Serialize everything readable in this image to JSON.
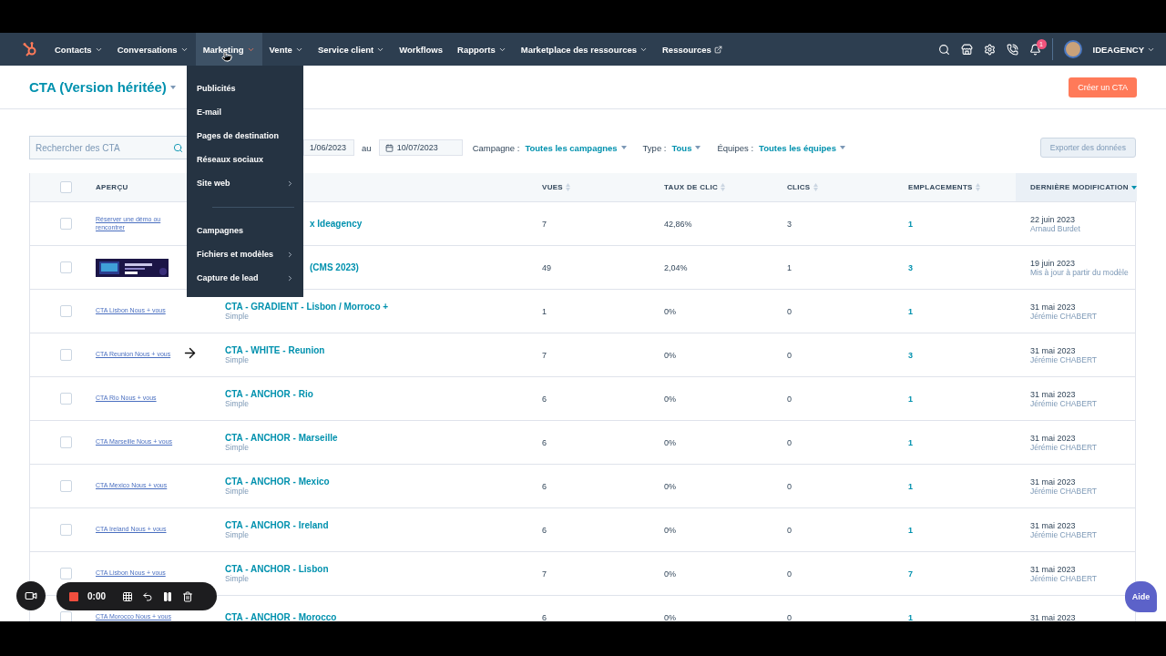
{
  "nav": {
    "items": [
      {
        "label": "Contacts",
        "kind": "dropdown",
        "selected": false
      },
      {
        "label": "Conversations",
        "kind": "dropdown",
        "selected": false
      },
      {
        "label": "Marketing",
        "kind": "dropdown",
        "selected": true
      },
      {
        "label": "Vente",
        "kind": "dropdown",
        "selected": false
      },
      {
        "label": "Service client",
        "kind": "dropdown",
        "selected": false
      },
      {
        "label": "Workflows",
        "kind": "plain",
        "selected": false
      },
      {
        "label": "Rapports",
        "kind": "dropdown",
        "selected": false
      },
      {
        "label": "Marketplace des ressources",
        "kind": "dropdown",
        "selected": false
      },
      {
        "label": "Ressources",
        "kind": "external",
        "selected": false
      }
    ],
    "notification_count": "1",
    "account": "IDEAGENCY"
  },
  "menu": {
    "items": [
      {
        "label": "Publicités",
        "kind": "plain"
      },
      {
        "label": "E-mail",
        "kind": "plain"
      },
      {
        "label": "Pages de destination",
        "kind": "plain"
      },
      {
        "label": "Réseaux sociaux",
        "kind": "plain"
      },
      {
        "label": "Site web",
        "kind": "submenu"
      },
      {
        "kind": "divider"
      },
      {
        "label": "Campagnes",
        "kind": "plain"
      },
      {
        "label": "Fichiers et modèles",
        "kind": "submenu"
      },
      {
        "label": "Capture de lead",
        "kind": "submenu"
      }
    ]
  },
  "header": {
    "title": "CTA (Version héritée)",
    "create_button": "Créer un CTA"
  },
  "filters": {
    "search_placeholder": "Rechercher des CTA",
    "date_from": "1/06/2023",
    "date_separator": "au",
    "date_to": "10/07/2023",
    "dropdowns": [
      {
        "label": "Campagne :",
        "value": "Toutes les campagnes"
      },
      {
        "label": "Type :",
        "value": "Tous"
      },
      {
        "label": "Équipes :",
        "value": "Toutes les équipes"
      }
    ],
    "export_button": "Exporter des données"
  },
  "table": {
    "select_all": {
      "checked": false
    },
    "columns": [
      {
        "label": "APERÇU",
        "sortable": false
      },
      {
        "label": "VUES",
        "sortable": true,
        "sorted": false
      },
      {
        "label": "TAUX DE CLIC",
        "sortable": true,
        "sorted": false
      },
      {
        "label": "CLICS",
        "sortable": true,
        "sorted": false
      },
      {
        "label": "EMPLACEMENTS",
        "sortable": true,
        "sorted": false
      },
      {
        "label": "DERNIÈRE MODIFICATION",
        "sortable": true,
        "sorted": true
      }
    ],
    "rows": [
      {
        "checked": false,
        "preview": {
          "kind": "link",
          "text": "Réserver une démo ou rencontrer"
        },
        "name": "x Ideagency",
        "partly_covered": true,
        "views": "7",
        "ctr": "42,86%",
        "clicks": "3",
        "placements": "1",
        "date": "22 juin 2023",
        "editor": "Arnaud Burdet"
      },
      {
        "checked": false,
        "name": "(CMS 2023)",
        "partly_covered": true,
        "views": "49",
        "ctr": "2,04%",
        "clicks": "1",
        "placements": "3",
        "date": "19 juin 2023",
        "editor": "Mis à jour à partir du modèle"
      },
      {
        "checked": false,
        "preview": {
          "kind": "link",
          "text": "CTA Lisbon Nous + vous"
        },
        "name": "CTA - GRADIENT - Lisbon / Morroco +",
        "partly_covered": false,
        "type": "Simple",
        "views": "1",
        "ctr": "0%",
        "clicks": "0",
        "placements": "1",
        "date": "31 mai 2023",
        "editor": "Jérémie CHABERT"
      },
      {
        "checked": false,
        "preview": {
          "kind": "link",
          "text": "CTA Reunion Nous + vous"
        },
        "name": "CTA - WHITE - Reunion",
        "partly_covered": false,
        "type": "Simple",
        "views": "7",
        "ctr": "0%",
        "clicks": "0",
        "placements": "3",
        "date": "31 mai 2023",
        "editor": "Jérémie CHABERT"
      },
      {
        "checked": false,
        "preview": {
          "kind": "link",
          "text": "CTA Rio Nous + vous"
        },
        "name": "CTA - ANCHOR - Rio",
        "partly_covered": false,
        "type": "Simple",
        "views": "6",
        "ctr": "0%",
        "clicks": "0",
        "placements": "1",
        "date": "31 mai 2023",
        "editor": "Jérémie CHABERT"
      },
      {
        "checked": false,
        "preview": {
          "kind": "link",
          "text": "CTA Marseille Nous + vous"
        },
        "name": "CTA - ANCHOR - Marseille",
        "partly_covered": false,
        "type": "Simple",
        "views": "6",
        "ctr": "0%",
        "clicks": "0",
        "placements": "1",
        "date": "31 mai 2023",
        "editor": "Jérémie CHABERT"
      },
      {
        "checked": false,
        "preview": {
          "kind": "link",
          "text": "CTA Mexico Nous + vous"
        },
        "name": "CTA - ANCHOR - Mexico",
        "partly_covered": false,
        "type": "Simple",
        "views": "6",
        "ctr": "0%",
        "clicks": "0",
        "placements": "1",
        "date": "31 mai 2023",
        "editor": "Jérémie CHABERT"
      },
      {
        "checked": false,
        "preview": {
          "kind": "link",
          "text": "CTA Ireland Nous + vous"
        },
        "name": "CTA - ANCHOR - Ireland",
        "partly_covered": false,
        "type": "Simple",
        "views": "6",
        "ctr": "0%",
        "clicks": "0",
        "placements": "1",
        "date": "31 mai 2023",
        "editor": "Jérémie CHABERT"
      },
      {
        "checked": false,
        "preview": {
          "kind": "link",
          "text": "CTA Lisbon Nous + vous"
        },
        "name": "CTA - ANCHOR - Lisbon",
        "partly_covered": false,
        "type": "Simple",
        "views": "7",
        "ctr": "0%",
        "clicks": "0",
        "placements": "7",
        "date": "31 mai 2023",
        "editor": "Jérémie CHABERT"
      },
      {
        "checked": false,
        "preview": {
          "kind": "link",
          "text": "CTA Morocco Nous + vous"
        },
        "name": "CTA - ANCHOR - Morocco",
        "partly_covered": false,
        "views": "6",
        "ctr": "0%",
        "clicks": "0",
        "placements": "1",
        "date": "31 mai 2023"
      }
    ]
  },
  "recorder": {
    "time": "0:00"
  },
  "help_button": "Aide"
}
